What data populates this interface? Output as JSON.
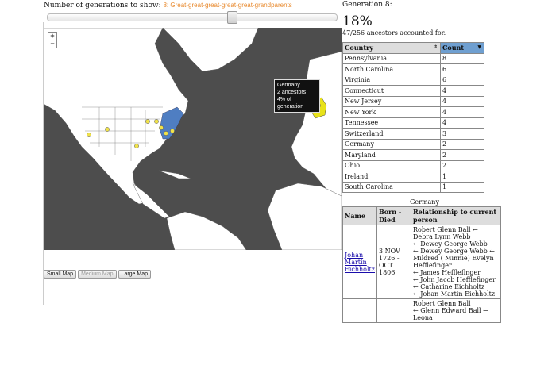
{
  "generations": {
    "label": "Number of generations to show:",
    "selected": "8: Great-great-great-great-great-grandparents"
  },
  "slider": {
    "value": 8
  },
  "map": {
    "zoom_in": "+",
    "zoom_out": "−",
    "tooltip": {
      "country": "Germany",
      "ancestors": "2 ancestors",
      "share": "4% of generation"
    },
    "colors": {
      "ocean": "#4d4d4d",
      "land": "#ffffff",
      "highlight_us": "#4f7ec2",
      "highlight_de": "#e8e21a",
      "marker": "#f0e24a"
    }
  },
  "map_buttons": {
    "small": "Small Map",
    "medium": "Medium Map",
    "large": "Large Map"
  },
  "summary": {
    "heading": "Generation 8:",
    "percent": "18%",
    "accounted": "47/256 ancestors accounted for."
  },
  "country_table": {
    "headers": {
      "country": "Country",
      "count": "Count"
    },
    "rows": [
      {
        "country": "Pennsylvania",
        "count": "8"
      },
      {
        "country": "North Carolina",
        "count": "6"
      },
      {
        "country": "Virginia",
        "count": "6"
      },
      {
        "country": "Connecticut",
        "count": "4"
      },
      {
        "country": "New Jersey",
        "count": "4"
      },
      {
        "country": "New York",
        "count": "4"
      },
      {
        "country": "Tennessee",
        "count": "4"
      },
      {
        "country": "Switzerland",
        "count": "3"
      },
      {
        "country": "Germany",
        "count": "2"
      },
      {
        "country": "Maryland",
        "count": "2"
      },
      {
        "country": "Ohio",
        "count": "2"
      },
      {
        "country": "Ireland",
        "count": "1"
      },
      {
        "country": "South Carolina",
        "count": "1"
      }
    ]
  },
  "selected_country": "Germany",
  "people_table": {
    "headers": {
      "name": "Name",
      "dates": "Born - Died",
      "rel": "Relationship to current person"
    },
    "rows": [
      {
        "name": "Johan Martin Eichholtz",
        "dates": "3 NOV 1726 - OCT 1806",
        "rel": [
          "Robert Glenn Ball ← Debra Lynn Webb",
          "← Dewey George Webb",
          "← Dewey George Webb ← Mildred ( Minnie) Evelyn Hefflefinger",
          "← James Hefflefinger",
          "← John Jacob Hefflefinger ← Catharine Eichholtz",
          "← Johan Martin Eichholtz"
        ]
      },
      {
        "name": "",
        "dates": "",
        "rel": [
          "Robert Glenn Ball",
          "← Glenn Edward Ball ← Leona"
        ]
      }
    ]
  }
}
